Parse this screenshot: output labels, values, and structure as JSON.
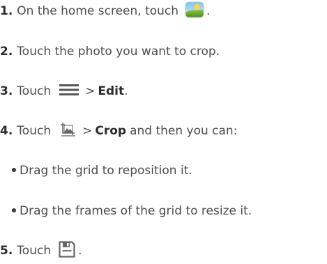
{
  "steps": [
    {
      "number": "1.",
      "text_before": "On the home screen, touch",
      "icon": "gallery-icon",
      "text_after": "."
    },
    {
      "number": "2.",
      "text": "Touch the photo you want to crop."
    },
    {
      "number": "3.",
      "text_before": "Touch",
      "icon": "menu-icon",
      "separator": ">",
      "bold": "Edit",
      "text_after": "."
    },
    {
      "number": "4.",
      "text_before": "Touch",
      "icon": "crop-icon",
      "separator": ">",
      "bold": "Crop",
      "text_after": "and then you can:",
      "bullets": [
        "Drag the grid to reposition it.",
        "Drag the frames of the grid to resize it."
      ]
    },
    {
      "number": "5.",
      "text_before": "Touch",
      "icon": "save-icon",
      "text_after": "."
    }
  ],
  "colors": {
    "text": "#4d4d4d",
    "bold_text": "#2b2b2b",
    "icon_gray": "#666666"
  }
}
